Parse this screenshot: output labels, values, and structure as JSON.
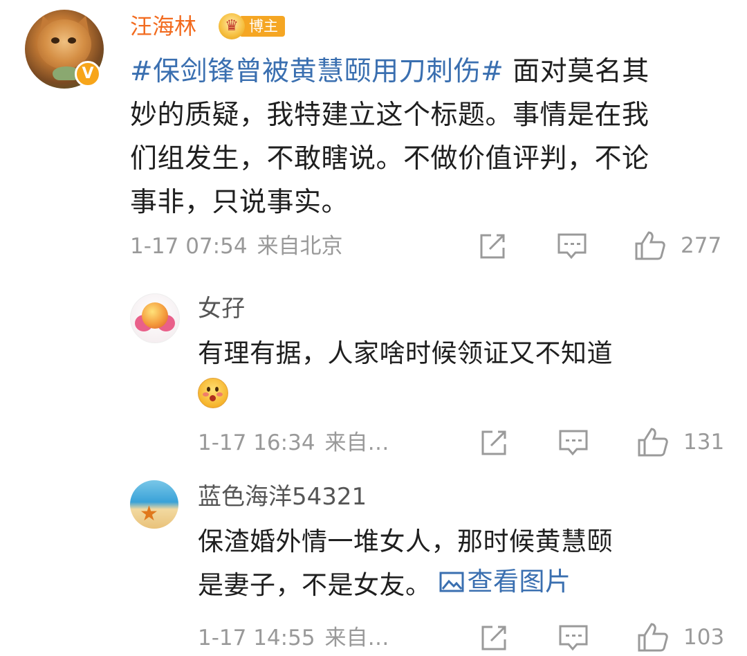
{
  "post": {
    "author": "汪海林",
    "badge_label": "博主",
    "hashtag": "#保剑锋曾被黄慧颐用刀刺伤#",
    "body_lines": [
      " 面对莫名其",
      "妙的质疑，我特建立这个标题。事情是在我",
      "们组发生，不敢瞎说。不做价值评判，不论",
      "事非，只说事实。"
    ],
    "time": "1-17 07:54",
    "location": "来自北京",
    "likes": "277"
  },
  "comments": [
    {
      "name": "女孖",
      "text": "有理有据，人家啥时候领证又不知道",
      "time": "1-17 16:34",
      "location": "来自…",
      "likes": "131"
    },
    {
      "name": "蓝色海洋54321",
      "text_line1": "保渣婚外情一堆女人，那时候黄慧颐",
      "text_line2": "是妻子，不是女友。",
      "view_pic": "查看图片",
      "time": "1-17 14:55",
      "location": "来自…",
      "likes": "103"
    }
  ],
  "icons": {
    "share": "share-icon",
    "comment": "comment-icon",
    "like": "thumbs-up-icon",
    "image": "image-icon",
    "verified": "verified-v-icon",
    "crown": "crown-icon"
  },
  "colors": {
    "author_orange": "#f26b1f",
    "link_blue": "#3a6fb0",
    "meta_gray": "#999999",
    "badge_orange": "#f5a623"
  }
}
